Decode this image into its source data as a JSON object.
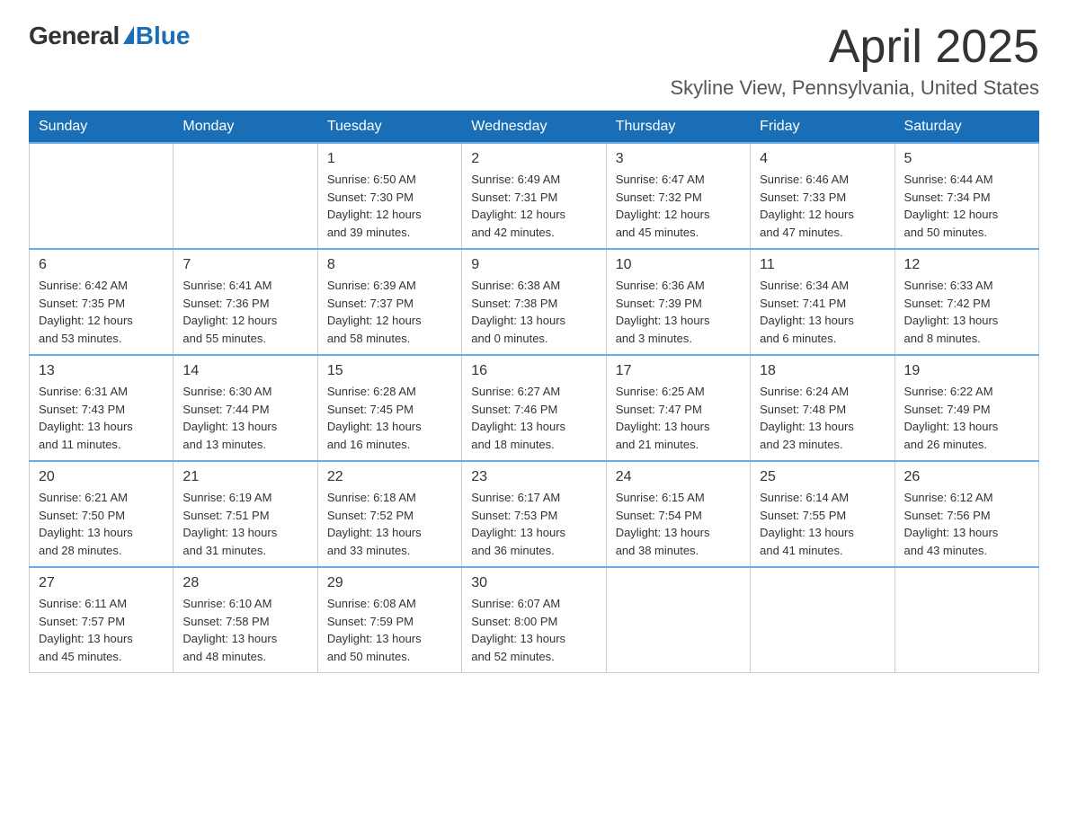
{
  "logo": {
    "general": "General",
    "blue": "Blue"
  },
  "title": {
    "month_year": "April 2025",
    "location": "Skyline View, Pennsylvania, United States"
  },
  "headers": [
    "Sunday",
    "Monday",
    "Tuesday",
    "Wednesday",
    "Thursday",
    "Friday",
    "Saturday"
  ],
  "weeks": [
    [
      {
        "day": "",
        "info": ""
      },
      {
        "day": "",
        "info": ""
      },
      {
        "day": "1",
        "info": "Sunrise: 6:50 AM\nSunset: 7:30 PM\nDaylight: 12 hours\nand 39 minutes."
      },
      {
        "day": "2",
        "info": "Sunrise: 6:49 AM\nSunset: 7:31 PM\nDaylight: 12 hours\nand 42 minutes."
      },
      {
        "day": "3",
        "info": "Sunrise: 6:47 AM\nSunset: 7:32 PM\nDaylight: 12 hours\nand 45 minutes."
      },
      {
        "day": "4",
        "info": "Sunrise: 6:46 AM\nSunset: 7:33 PM\nDaylight: 12 hours\nand 47 minutes."
      },
      {
        "day": "5",
        "info": "Sunrise: 6:44 AM\nSunset: 7:34 PM\nDaylight: 12 hours\nand 50 minutes."
      }
    ],
    [
      {
        "day": "6",
        "info": "Sunrise: 6:42 AM\nSunset: 7:35 PM\nDaylight: 12 hours\nand 53 minutes."
      },
      {
        "day": "7",
        "info": "Sunrise: 6:41 AM\nSunset: 7:36 PM\nDaylight: 12 hours\nand 55 minutes."
      },
      {
        "day": "8",
        "info": "Sunrise: 6:39 AM\nSunset: 7:37 PM\nDaylight: 12 hours\nand 58 minutes."
      },
      {
        "day": "9",
        "info": "Sunrise: 6:38 AM\nSunset: 7:38 PM\nDaylight: 13 hours\nand 0 minutes."
      },
      {
        "day": "10",
        "info": "Sunrise: 6:36 AM\nSunset: 7:39 PM\nDaylight: 13 hours\nand 3 minutes."
      },
      {
        "day": "11",
        "info": "Sunrise: 6:34 AM\nSunset: 7:41 PM\nDaylight: 13 hours\nand 6 minutes."
      },
      {
        "day": "12",
        "info": "Sunrise: 6:33 AM\nSunset: 7:42 PM\nDaylight: 13 hours\nand 8 minutes."
      }
    ],
    [
      {
        "day": "13",
        "info": "Sunrise: 6:31 AM\nSunset: 7:43 PM\nDaylight: 13 hours\nand 11 minutes."
      },
      {
        "day": "14",
        "info": "Sunrise: 6:30 AM\nSunset: 7:44 PM\nDaylight: 13 hours\nand 13 minutes."
      },
      {
        "day": "15",
        "info": "Sunrise: 6:28 AM\nSunset: 7:45 PM\nDaylight: 13 hours\nand 16 minutes."
      },
      {
        "day": "16",
        "info": "Sunrise: 6:27 AM\nSunset: 7:46 PM\nDaylight: 13 hours\nand 18 minutes."
      },
      {
        "day": "17",
        "info": "Sunrise: 6:25 AM\nSunset: 7:47 PM\nDaylight: 13 hours\nand 21 minutes."
      },
      {
        "day": "18",
        "info": "Sunrise: 6:24 AM\nSunset: 7:48 PM\nDaylight: 13 hours\nand 23 minutes."
      },
      {
        "day": "19",
        "info": "Sunrise: 6:22 AM\nSunset: 7:49 PM\nDaylight: 13 hours\nand 26 minutes."
      }
    ],
    [
      {
        "day": "20",
        "info": "Sunrise: 6:21 AM\nSunset: 7:50 PM\nDaylight: 13 hours\nand 28 minutes."
      },
      {
        "day": "21",
        "info": "Sunrise: 6:19 AM\nSunset: 7:51 PM\nDaylight: 13 hours\nand 31 minutes."
      },
      {
        "day": "22",
        "info": "Sunrise: 6:18 AM\nSunset: 7:52 PM\nDaylight: 13 hours\nand 33 minutes."
      },
      {
        "day": "23",
        "info": "Sunrise: 6:17 AM\nSunset: 7:53 PM\nDaylight: 13 hours\nand 36 minutes."
      },
      {
        "day": "24",
        "info": "Sunrise: 6:15 AM\nSunset: 7:54 PM\nDaylight: 13 hours\nand 38 minutes."
      },
      {
        "day": "25",
        "info": "Sunrise: 6:14 AM\nSunset: 7:55 PM\nDaylight: 13 hours\nand 41 minutes."
      },
      {
        "day": "26",
        "info": "Sunrise: 6:12 AM\nSunset: 7:56 PM\nDaylight: 13 hours\nand 43 minutes."
      }
    ],
    [
      {
        "day": "27",
        "info": "Sunrise: 6:11 AM\nSunset: 7:57 PM\nDaylight: 13 hours\nand 45 minutes."
      },
      {
        "day": "28",
        "info": "Sunrise: 6:10 AM\nSunset: 7:58 PM\nDaylight: 13 hours\nand 48 minutes."
      },
      {
        "day": "29",
        "info": "Sunrise: 6:08 AM\nSunset: 7:59 PM\nDaylight: 13 hours\nand 50 minutes."
      },
      {
        "day": "30",
        "info": "Sunrise: 6:07 AM\nSunset: 8:00 PM\nDaylight: 13 hours\nand 52 minutes."
      },
      {
        "day": "",
        "info": ""
      },
      {
        "day": "",
        "info": ""
      },
      {
        "day": "",
        "info": ""
      }
    ]
  ]
}
